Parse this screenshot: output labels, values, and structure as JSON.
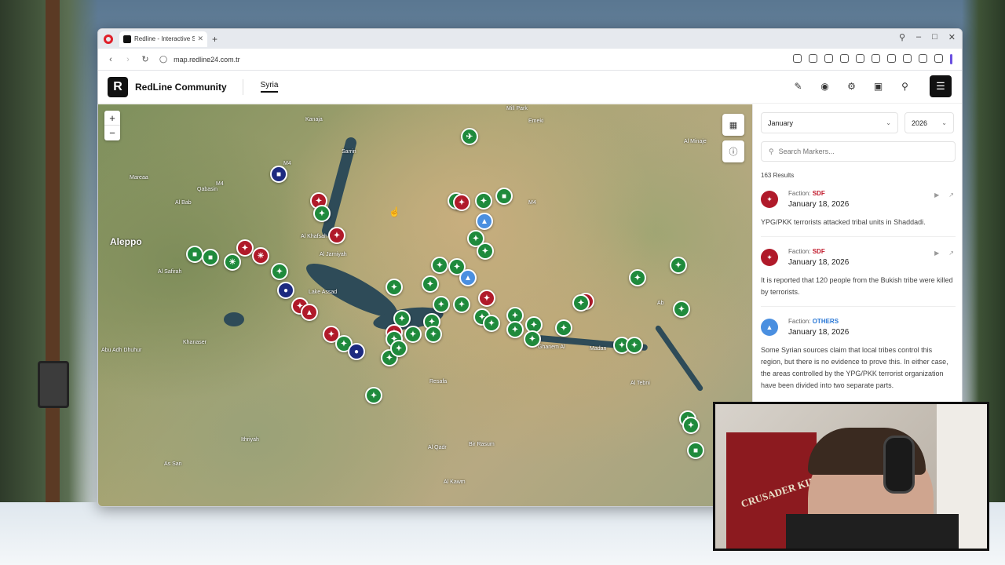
{
  "browser": {
    "tab_title": "Redline - Interactive Strat",
    "tab_close": "✕",
    "new_tab": "+",
    "url": "map.redline24.com.tr"
  },
  "header": {
    "logo_letter": "R",
    "brand": "RedLine Community",
    "country_tab": "Syria"
  },
  "map": {
    "zoom_in": "+",
    "zoom_out": "−",
    "labels": [
      {
        "text": "Aleppo"
      },
      {
        "text": "Kanaja"
      },
      {
        "text": "Sarrin"
      },
      {
        "text": "Mill Park"
      },
      {
        "text": "Emeki"
      },
      {
        "text": "Al Bab"
      },
      {
        "text": "Qabasin"
      },
      {
        "text": "Mareaa"
      },
      {
        "text": "Al Khafsah"
      },
      {
        "text": "Al Jarniyah"
      },
      {
        "text": "Al Safirah"
      },
      {
        "text": "Lake Assad"
      },
      {
        "text": "Khanaser"
      },
      {
        "text": "Abu Adh Dhuhur"
      },
      {
        "text": "Resafa"
      },
      {
        "text": "Ghanem Al"
      },
      {
        "text": "Madan"
      },
      {
        "text": "Al Tebni"
      },
      {
        "text": "Ithriyah"
      },
      {
        "text": "As San"
      },
      {
        "text": "Al Qadr"
      },
      {
        "text": "Bir Rasum"
      },
      {
        "text": "Al Kawm"
      },
      {
        "text": "Al Minaje"
      },
      {
        "text": "Ab"
      },
      {
        "text": "M4"
      },
      {
        "text": "M4"
      },
      {
        "text": "M4"
      }
    ]
  },
  "sidebar": {
    "month": "January",
    "year": "2026",
    "search_placeholder": "Search Markers...",
    "results": "163 Results",
    "entries": [
      {
        "faction_prefix": "Faction:",
        "faction": "SDF",
        "date": "January 18, 2026",
        "text": "YPG/PKK terrorists attacked tribal units in Shaddadi."
      },
      {
        "faction_prefix": "Faction:",
        "faction": "SDF",
        "date": "January 18, 2026",
        "text": "It is reported that 120 people from the Bukish tribe were killed by terrorists."
      },
      {
        "faction_prefix": "Faction:",
        "faction": "OTHERS",
        "date": "January 18, 2026",
        "text": "Some Syrian sources claim that local tribes control this region, but there is no evidence to prove this. In either case, the areas controlled by the YPG/PKK terrorist organization have been divided into two separate parts."
      }
    ]
  },
  "webcam": {
    "poster_text": "CRUSADER KINGS III"
  },
  "colors": {
    "sdf_red": "#b01a2a",
    "others_blue": "#4a8fe0",
    "government_green": "#1f8a3c",
    "navy": "#1c2a80"
  }
}
